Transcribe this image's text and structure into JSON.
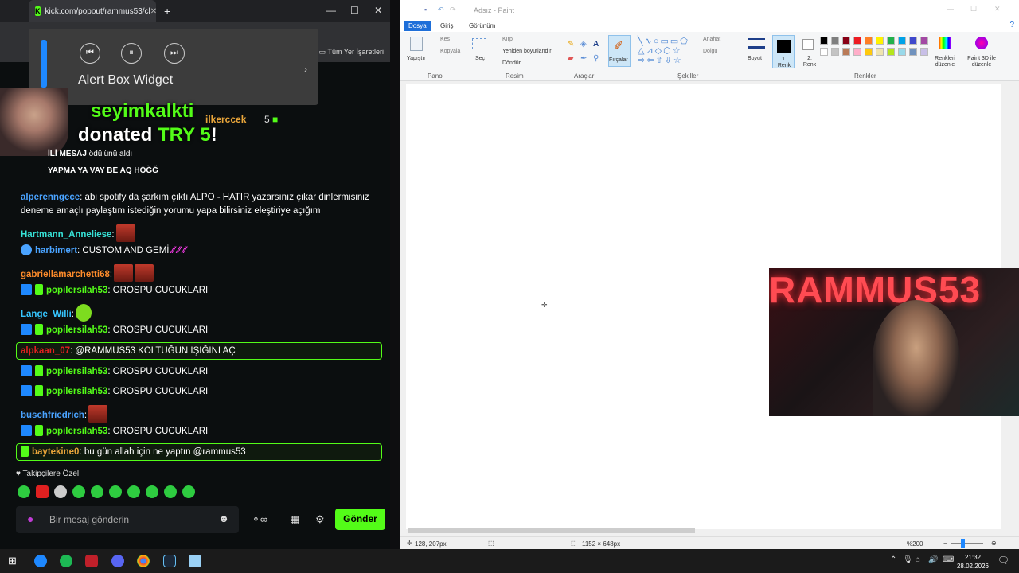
{
  "browser": {
    "tab_title": "kick.com/popout/rammus53/cl",
    "bookmarks_label": "Tüm Yer İşaretleri",
    "media_widget_title": "Alert Box Widget"
  },
  "alert": {
    "username": "seyimkalkti",
    "donated_prefix": "donated ",
    "amount": "TRY 5",
    "suffix": "!"
  },
  "pinned": {
    "user": "ilkerccek",
    "count": "5"
  },
  "reward": {
    "text_bold": "İLİ MESAJ",
    "text_rest": " ödülünü aldı",
    "message": "YAPMA YA VAY BE AQ HÖĞĞ"
  },
  "chat": {
    "messages": [
      {
        "user": "alperenngece",
        "text": ": abi spotify da şarkım çıktı ALPO - HATIR yazarsınız çıkar dinlermisiniz deneme amaçlı paylaştım istediğin yorumu yapa bilirsiniz eleştiriye açığım",
        "color": "#4aa3ff"
      },
      {
        "user": "Hartmann_Anneliese",
        "text": ":",
        "color": "#36e1d6"
      },
      {
        "user": "harbimert",
        "text": ": CUSTOM AND GEMİ",
        "color": "#4aa3ff"
      },
      {
        "user": "gabriellamarchetti68",
        "text": ":",
        "color": "#ff8c2b"
      },
      {
        "user": "popilersilah53",
        "text": ": OROSPU CUCUKLARI",
        "color": "#53fc18"
      },
      {
        "user": "Lange_Willi",
        "text": ":",
        "color": "#36c6ff"
      },
      {
        "user": "popilersilah53",
        "text": ": OROSPU CUCUKLARI",
        "color": "#53fc18"
      },
      {
        "user": "alpkaan_07",
        "text": ": @RAMMUS53 KOLTUĞUN IŞIĞINI AÇ",
        "color": "#e02020"
      },
      {
        "user": "popilersilah53",
        "text": ": OROSPU CUCUKLARI",
        "color": "#53fc18"
      },
      {
        "user": "popilersilah53",
        "text": ": OROSPU CUCUKLARI",
        "color": "#53fc18"
      },
      {
        "user": "buschfriedrich",
        "text": ":",
        "color": "#4aa3ff"
      },
      {
        "user": "popilersilah53",
        "text": ": OROSPU CUCUKLARI",
        "color": "#53fc18"
      },
      {
        "user": "baytekine0",
        "text": ": bu gün allah için ne yaptın @rammus53",
        "color": "#e9a53a"
      }
    ],
    "followers_label": "Takipçilere Özel",
    "input_placeholder": "Bir mesaj gönderin",
    "send_label": "Gönder"
  },
  "paint": {
    "title": "Adsız - Paint",
    "tabs": [
      "Dosya",
      "Giriş",
      "Görünüm"
    ],
    "groups": {
      "pano": "Pano",
      "resim": "Resim",
      "araclar": "Araçlar",
      "sekiller": "Şekiller",
      "renkler": "Renkler"
    },
    "buttons": {
      "yapistir": "Yapıştır",
      "kes": "Kes",
      "kopyala": "Kopyala",
      "sec": "Seç",
      "kirp": "Kırp",
      "yeniden": "Yeniden boyutlandır",
      "dondur": "Döndür",
      "fircalar": "Fırçalar",
      "anahat": "Anahat",
      "dolgu": "Dolgu",
      "boyut": "Boyut",
      "renk1": "1. Renk",
      "renk2": "2. Renk",
      "renkleri_duzenle": "Renkleri düzenle",
      "paint3d": "Paint 3D ile düzenle"
    },
    "status": {
      "cursor": "128, 207px",
      "size": "1152 × 648px",
      "zoom": "%200"
    },
    "palette": [
      "#000000",
      "#7f7f7f",
      "#880015",
      "#ed1c24",
      "#ff7f27",
      "#fff200",
      "#22b14c",
      "#00a2e8",
      "#3f48cc",
      "#a349a4",
      "#ffffff",
      "#c3c3c3",
      "#b97a57",
      "#ffaec9",
      "#ffc90e",
      "#efe4b0",
      "#b5e61d",
      "#99d9ea",
      "#7092be",
      "#c8bfe7"
    ]
  },
  "webcam_text": "RAMMUS53",
  "clock": {
    "time": "21:32",
    "date": "28.02.2026"
  }
}
